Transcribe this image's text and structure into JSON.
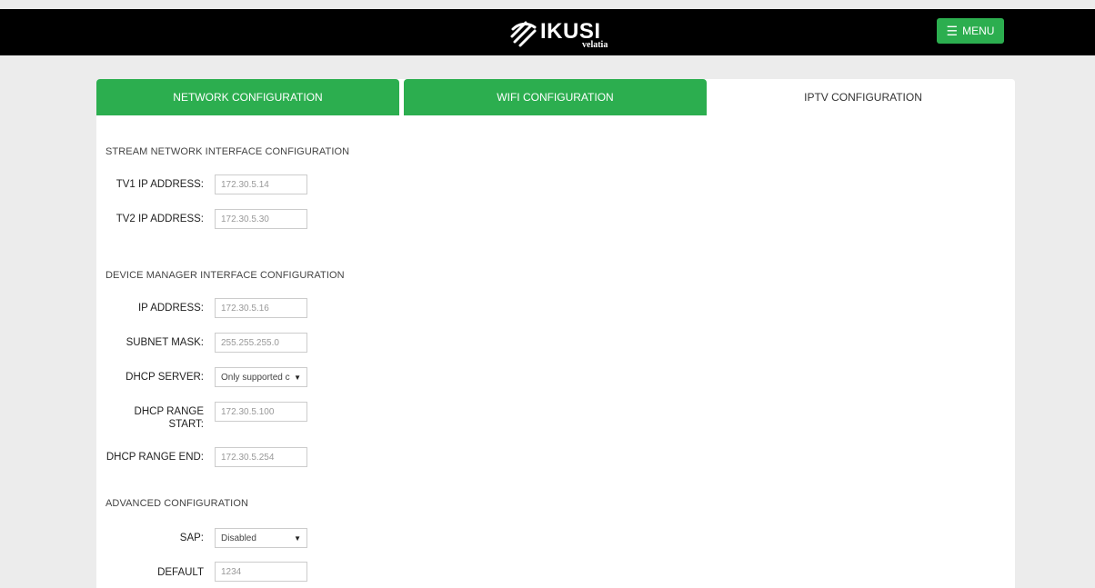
{
  "header": {
    "logo_text": "IKUSI",
    "logo_sub": "velatia",
    "menu_label": "MENU",
    "accent_color": "#2cae4f"
  },
  "tabs": [
    {
      "label": "NETWORK CONFIGURATION",
      "active": false
    },
    {
      "label": "WIFI CONFIGURATION",
      "active": false
    },
    {
      "label": "IPTV CONFIGURATION",
      "active": true
    }
  ],
  "sections": {
    "stream": {
      "title": "STREAM NETWORK INTERFACE CONFIGURATION",
      "fields": [
        {
          "label": "TV1 IP ADDRESS:",
          "placeholder": "172.30.5.14"
        },
        {
          "label": "TV2 IP ADDRESS:",
          "placeholder": "172.30.5.30"
        }
      ]
    },
    "device": {
      "title": "DEVICE MANAGER INTERFACE CONFIGURATION",
      "ip_label": "IP ADDRESS:",
      "ip_placeholder": "172.30.5.16",
      "mask_label": "SUBNET MASK:",
      "mask_placeholder": "255.255.255.0",
      "dhcp_server_label": "DHCP SERVER:",
      "dhcp_server_value": "Only supported c",
      "range_start_label_1": "DHCP RANGE",
      "range_start_label_2": "START:",
      "range_start_placeholder": "172.30.5.100",
      "range_end_label": "DHCP RANGE END:",
      "range_end_placeholder": "172.30.5.254"
    },
    "advanced": {
      "title": "ADVANCED CONFIGURATION",
      "sap_label": "SAP:",
      "sap_value": "Disabled",
      "default_label": "DEFAULT",
      "default_placeholder": "1234"
    }
  }
}
